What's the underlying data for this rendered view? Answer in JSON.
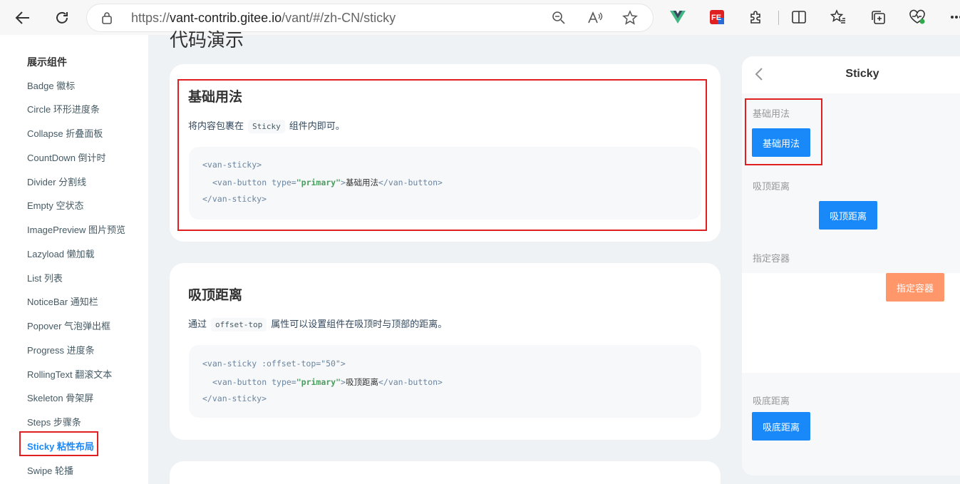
{
  "browser": {
    "url_prefix": "https://",
    "url_host": "vant-contrib.gitee.io",
    "url_path": "/vant/#/zh-CN/sticky"
  },
  "sidebar": {
    "group_title": "展示组件",
    "items": [
      {
        "label": "Badge 徽标"
      },
      {
        "label": "Circle 环形进度条"
      },
      {
        "label": "Collapse 折叠面板"
      },
      {
        "label": "CountDown 倒计时"
      },
      {
        "label": "Divider 分割线"
      },
      {
        "label": "Empty 空状态"
      },
      {
        "label": "ImagePreview 图片预览"
      },
      {
        "label": "Lazyload 懒加载"
      },
      {
        "label": "List 列表"
      },
      {
        "label": "NoticeBar 通知栏"
      },
      {
        "label": "Popover 气泡弹出框"
      },
      {
        "label": "Progress 进度条"
      },
      {
        "label": "RollingText 翻滚文本"
      },
      {
        "label": "Skeleton 骨架屏"
      },
      {
        "label": "Steps 步骤条"
      },
      {
        "label": "Sticky 粘性布局"
      },
      {
        "label": "Swipe 轮播"
      }
    ],
    "active_item": "Sticky 粘性布局"
  },
  "main": {
    "page_heading": "代码演示",
    "sections": [
      {
        "title": "基础用法",
        "desc_before": "将内容包裹在",
        "desc_code": "Sticky",
        "desc_after": "组件内即可。",
        "code": {
          "l1": "<van-sticky>",
          "l2_open": "<van-button",
          "l2_attr": " type=",
          "l2_str": "\"primary\"",
          "l2_close": ">",
          "l2_text": "基础用法",
          "l2_end": "</van-button>",
          "l3": "</van-sticky>"
        }
      },
      {
        "title": "吸顶距离",
        "desc_before": "通过",
        "desc_code": "offset-top",
        "desc_after": "属性可以设置组件在吸顶时与顶部的距离。",
        "code": {
          "l1": "<van-sticky :offset-top=\"50\">",
          "l2_open": "<van-button",
          "l2_attr": " type=",
          "l2_str": "\"primary\"",
          "l2_close": ">",
          "l2_text": "吸顶距离",
          "l2_end": "</van-button>",
          "l3": "</van-sticky>"
        }
      }
    ]
  },
  "phone": {
    "title": "Sticky",
    "sections": [
      {
        "label": "基础用法",
        "button": "基础用法"
      },
      {
        "label": "吸顶距离",
        "button": "吸顶距离"
      },
      {
        "label": "指定容器",
        "button": "指定容器"
      },
      {
        "label": "吸底距离",
        "button": "吸底距离"
      }
    ]
  },
  "colors": {
    "primary": "#1989fa",
    "warning": "#ff976a",
    "highlight": "#e02020"
  }
}
